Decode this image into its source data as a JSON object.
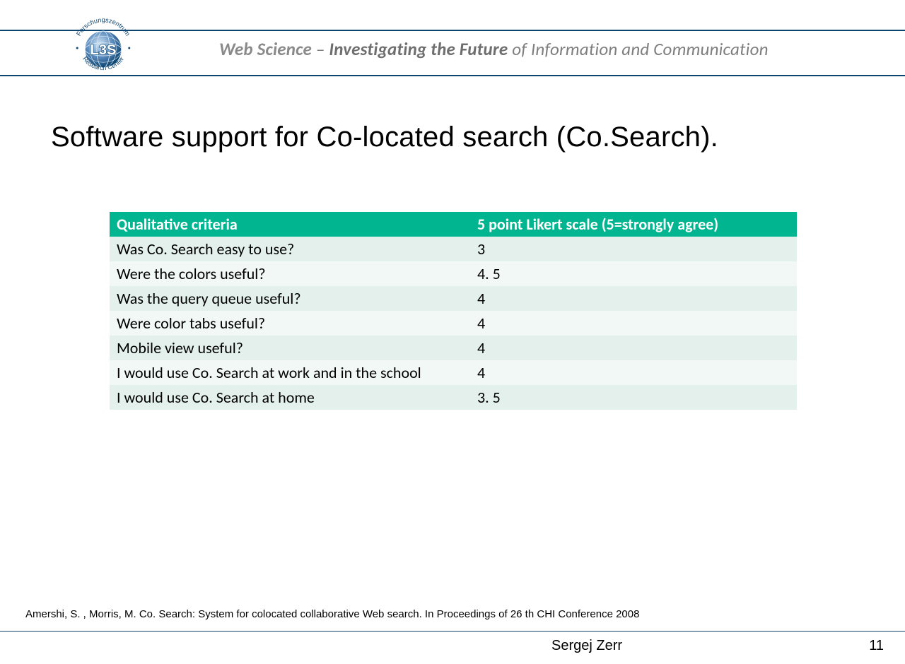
{
  "header": {
    "tagline_lead": "Web Science",
    "tagline_sep": " – ",
    "tagline_em": "Investigating the Future",
    "tagline_tail": " of Information and Communication",
    "logo_text": "L3S",
    "logo_arc_top": "Forschungszentrum",
    "logo_arc_bot": "Research Center"
  },
  "title": "Software support for Co-located search (Co.Search).",
  "table": {
    "headers": [
      "Qualitative criteria",
      "5 point Likert scale (5=strongly agree)"
    ],
    "rows": [
      [
        "Was Co. Search easy to use?",
        "3"
      ],
      [
        "Were the colors useful?",
        "4. 5"
      ],
      [
        "Was the query queue useful?",
        "4"
      ],
      [
        "Were color tabs useful?",
        "4"
      ],
      [
        "Mobile view useful?",
        "4"
      ],
      [
        "I would use Co. Search at work and in the school",
        "4"
      ],
      [
        "I would use Co. Search at home",
        "3. 5"
      ]
    ]
  },
  "citation": "Amershi, S. , Morris, M. Co. Search: System for colocated collaborative Web search. In Proceedings of 26 th CHI Conference 2008",
  "footer": {
    "author": "Sergej Zerr",
    "page": "11"
  },
  "chart_data": {
    "type": "table",
    "title": "Software support for Co-located search (Co.Search).",
    "columns": [
      "Qualitative criteria",
      "5 point Likert scale (5=strongly agree)"
    ],
    "rows": [
      {
        "criteria": "Was Co.Search easy to use?",
        "value": 3
      },
      {
        "criteria": "Were the colors useful?",
        "value": 4.5
      },
      {
        "criteria": "Was the query queue useful?",
        "value": 4
      },
      {
        "criteria": "Were color tabs useful?",
        "value": 4
      },
      {
        "criteria": "Mobile view useful?",
        "value": 4
      },
      {
        "criteria": "I would use Co.Search at work and in the school",
        "value": 4
      },
      {
        "criteria": "I would use Co.Search at home",
        "value": 3.5
      }
    ],
    "scale": {
      "min": 1,
      "max": 5,
      "anchor_high": "strongly agree"
    }
  }
}
